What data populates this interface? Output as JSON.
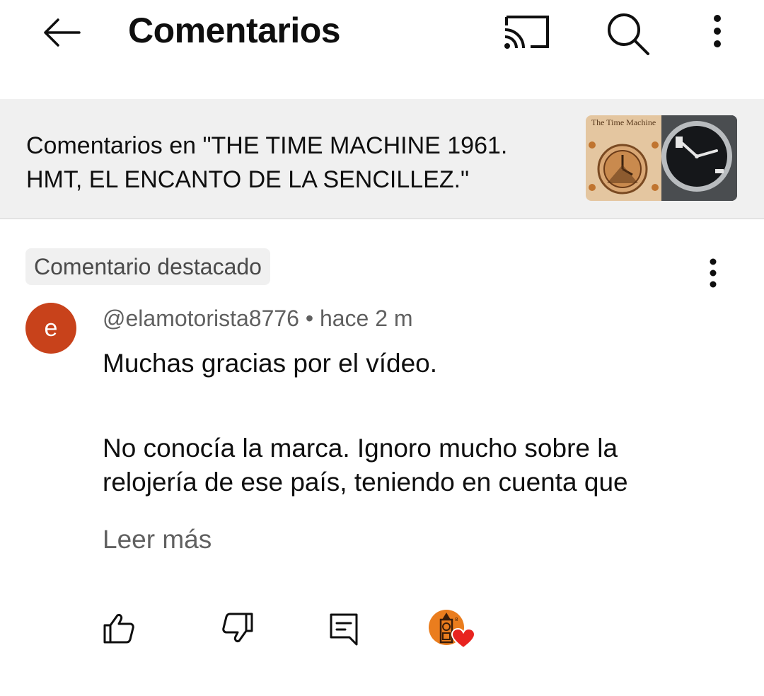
{
  "header": {
    "title": "Comentarios",
    "back_icon": "arrow-left-icon",
    "cast_icon": "cast-icon",
    "search_icon": "search-icon",
    "more_icon": "more-vert-icon"
  },
  "video": {
    "context_text": "Comentarios en \"THE TIME MACHINE  1961. HMT, EL ENCANTO DE LA SENCILLEZ.\"",
    "thumbnail_caption": "The Time Machine"
  },
  "comment": {
    "pinned_label": "Comentario destacado",
    "avatar_letter": "e",
    "avatar_color": "#c8421b",
    "author": "@elamotorista8776",
    "separator": "•",
    "time": "hace 2 m",
    "text_paragraph_1": "Muchas gracias por el vídeo.",
    "text_paragraph_2_line_1": "No conocía la marca. Ignoro mucho sobre la",
    "text_paragraph_2_line_2": "relojería de ese país, teniendo en cuenta que",
    "read_more": "Leer más",
    "heart_color": "#e8231f"
  },
  "actions": {
    "like_icon": "thumb-up-icon",
    "dislike_icon": "thumb-down-icon",
    "reply_icon": "reply-comment-icon",
    "creator_heart_icon": "creator-heart-icon"
  }
}
